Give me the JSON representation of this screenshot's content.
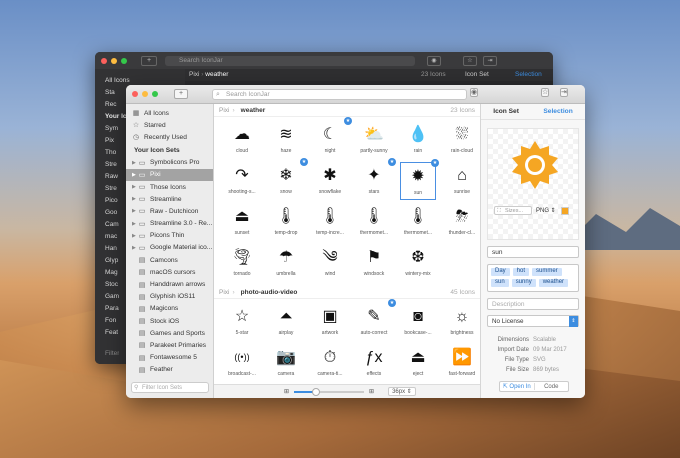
{
  "back_window": {
    "search_placeholder": "Search IconJar",
    "breadcrumb_set": "Pixi",
    "breadcrumb_group": "weather",
    "count": "23 Icons",
    "tab_iconset": "Icon Set",
    "tab_selection": "Selection",
    "sidebar": [
      "All Icons",
      "Sta",
      "Rec",
      "Your Icon",
      "Sym",
      "Pix",
      "Tho",
      "Stre",
      "Raw",
      "Stre",
      "Pico",
      "Goo",
      "Cam",
      "mac",
      "Han",
      "Glyp",
      "Mag",
      "Stoc",
      "Gam",
      "Para",
      "Fon",
      "Feat"
    ],
    "filter": "Filter"
  },
  "window": {
    "search_placeholder": "Search IconJar",
    "sidebar": {
      "top_items": [
        {
          "label": "All Icons",
          "icon": "all-icons-icon",
          "glyph": "▦"
        },
        {
          "label": "Starred",
          "icon": "star-icon",
          "glyph": "☆"
        },
        {
          "label": "Recently Used",
          "icon": "clock-icon",
          "glyph": "◷"
        }
      ],
      "section_title": "Your Icon Sets",
      "sets": [
        {
          "label": "Symbolicons Pro",
          "type": "folder",
          "arrow": true
        },
        {
          "label": "Pixi",
          "type": "folder",
          "arrow": true,
          "selected": true
        },
        {
          "label": "Those Icons",
          "type": "folder",
          "arrow": true
        },
        {
          "label": "Streamline",
          "type": "folder",
          "arrow": true
        },
        {
          "label": "Raw - Dutchicon",
          "type": "folder",
          "arrow": true
        },
        {
          "label": "Streamline 3.0 - Re...",
          "type": "folder",
          "arrow": true
        },
        {
          "label": "Picons Thin",
          "type": "folder",
          "arrow": true
        },
        {
          "label": "Google Material ico...",
          "type": "folder",
          "arrow": true
        },
        {
          "label": "Camcons",
          "type": "box"
        },
        {
          "label": "macOS cursors",
          "type": "box"
        },
        {
          "label": "Handdrawn arrows",
          "type": "box"
        },
        {
          "label": "Glyphish iOS11",
          "type": "box"
        },
        {
          "label": "Magicons",
          "type": "box"
        },
        {
          "label": "Stock iOS",
          "type": "box"
        },
        {
          "label": "Games and Sports",
          "type": "box"
        },
        {
          "label": "Parakeet Primaries",
          "type": "box"
        },
        {
          "label": "Fontawesome 5",
          "type": "box"
        },
        {
          "label": "Feather",
          "type": "box"
        }
      ],
      "filter_placeholder": "Filter Icon Sets"
    },
    "sections": [
      {
        "set": "Pixi",
        "group": "weather",
        "count": "23 Icons",
        "icons": [
          {
            "label": "cloud",
            "glyph": "☁"
          },
          {
            "label": "haze",
            "glyph": "≋"
          },
          {
            "label": "night",
            "glyph": "☾",
            "badge": true
          },
          {
            "label": "partly-sunny",
            "glyph": "⛅"
          },
          {
            "label": "rain",
            "glyph": "💧"
          },
          {
            "label": "rain-cloud",
            "glyph": "⛆"
          },
          {
            "label": "shooting-s...",
            "glyph": "↷"
          },
          {
            "label": "snow",
            "glyph": "❄",
            "badge": true
          },
          {
            "label": "snowflake",
            "glyph": "✱"
          },
          {
            "label": "stars",
            "glyph": "✦",
            "badge": true
          },
          {
            "label": "sun",
            "glyph": "✹",
            "selected": true,
            "badge": true
          },
          {
            "label": "sunrise",
            "glyph": "⌂"
          },
          {
            "label": "sunset",
            "glyph": "⏏"
          },
          {
            "label": "temp-drop",
            "glyph": "🌡"
          },
          {
            "label": "temp-incre...",
            "glyph": "🌡"
          },
          {
            "label": "thermomet...",
            "glyph": "🌡"
          },
          {
            "label": "thermomet...",
            "glyph": "🌡"
          },
          {
            "label": "thunder-cl...",
            "glyph": "⛈"
          },
          {
            "label": "tornado",
            "glyph": "🌪"
          },
          {
            "label": "umbrella",
            "glyph": "☂"
          },
          {
            "label": "wind",
            "glyph": "༄"
          },
          {
            "label": "windsock",
            "glyph": "⚑"
          },
          {
            "label": "wintery-mix",
            "glyph": "❆"
          }
        ]
      },
      {
        "set": "Pixi",
        "group": "photo-audio-video",
        "count": "45 Icons",
        "icons": [
          {
            "label": "5-star",
            "glyph": "☆"
          },
          {
            "label": "airplay",
            "glyph": "⏶"
          },
          {
            "label": "artwork",
            "glyph": "▣"
          },
          {
            "label": "auto-correct",
            "glyph": "✎",
            "badge": true
          },
          {
            "label": "bookcase-...",
            "glyph": "◙"
          },
          {
            "label": "brightness",
            "glyph": "☼"
          },
          {
            "label": "broadcast-...",
            "glyph": "((•))"
          },
          {
            "label": "camera",
            "glyph": "📷"
          },
          {
            "label": "camera-ti...",
            "glyph": "⏱"
          },
          {
            "label": "effects",
            "glyph": "ƒx"
          },
          {
            "label": "eject",
            "glyph": "⏏"
          },
          {
            "label": "fast-forward",
            "glyph": "⏩"
          }
        ]
      }
    ],
    "bottombar": {
      "size_label": "36px"
    },
    "inspector": {
      "tab_iconset": "Icon Set",
      "tab_selection": "Selection",
      "sizes_placeholder": "Sizes...",
      "format": "PNG",
      "export_color": "#f5a623",
      "name_value": "sun",
      "tags": [
        "Day",
        "hot",
        "summer",
        "sun",
        "sunny",
        "weather"
      ],
      "description_placeholder": "Description",
      "license": "No License",
      "meta": [
        {
          "key": "Dimensions",
          "value": "Scalable"
        },
        {
          "key": "Import Date",
          "value": "09 Mar 2017"
        },
        {
          "key": "File Type",
          "value": "SVG"
        },
        {
          "key": "File Size",
          "value": "869 bytes"
        }
      ],
      "open_in": "Open In",
      "code": "Code"
    }
  },
  "colors": {
    "accent": "#3d8de0",
    "sun": "#f5a623"
  }
}
